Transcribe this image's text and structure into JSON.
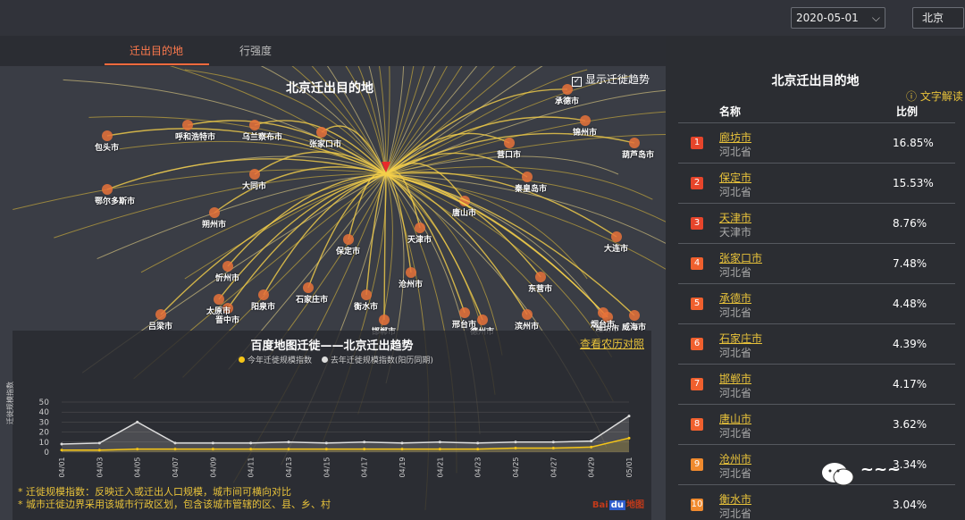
{
  "topbar": {
    "date": "2020-05-01",
    "city": "北京"
  },
  "tabs": {
    "destination": "迁出目的地",
    "intensity": "行强度"
  },
  "map": {
    "title": "北京迁出目的地",
    "trend_toggle": "显示迁徙趋势",
    "origin": "北京",
    "cities": [
      "包头市",
      "呼和浩特市",
      "乌兰察布市",
      "张家口市",
      "秦皇岛市",
      "鄂尔多斯市",
      "大同市",
      "唐山市",
      "朔州市",
      "保定市",
      "天津市",
      "沧州市",
      "忻州市",
      "石家庄市",
      "太原市",
      "晋中市",
      "阳泉市",
      "邯郸市",
      "吕梁市",
      "衡水市",
      "邢台市",
      "德州市",
      "滨州市",
      "东营市",
      "潍坊市",
      "烟台市",
      "威海市",
      "大连市",
      "营口市",
      "锦州市",
      "葫芦岛市",
      "承德市"
    ]
  },
  "trend": {
    "title": "百度地图迁徙——北京迁出趋势",
    "lunar_link": "查看农历对照",
    "legend_this_year": "今年迁徙规模指数",
    "legend_last_year": "去年迁徙规模指数(阳历同期)",
    "y_axis_label": "迁徙规模指数",
    "notes": [
      "* 迁徙规模指数：反映迁入或迁出人口规模，城市间可横向对比",
      "* 城市迁徙边界采用该城市行政区划，包含该城市管辖的区、县、乡、村"
    ],
    "logo": "Bai du 地图"
  },
  "panel": {
    "title": "北京迁出目的地",
    "interpret": "文字解读",
    "col_name": "名称",
    "col_ratio": "比例",
    "rows": [
      {
        "rank": "1",
        "name": "廊坊市",
        "province": "河北省",
        "pct": "16.85%",
        "color": "#e7452b"
      },
      {
        "rank": "2",
        "name": "保定市",
        "province": "河北省",
        "pct": "15.53%",
        "color": "#e7452b"
      },
      {
        "rank": "3",
        "name": "天津市",
        "province": "天津市",
        "pct": "8.76%",
        "color": "#e7452b"
      },
      {
        "rank": "4",
        "name": "张家口市",
        "province": "河北省",
        "pct": "7.48%",
        "color": "#f0602e"
      },
      {
        "rank": "5",
        "name": "承德市",
        "province": "河北省",
        "pct": "4.48%",
        "color": "#f0602e"
      },
      {
        "rank": "6",
        "name": "石家庄市",
        "province": "河北省",
        "pct": "4.39%",
        "color": "#f0602e"
      },
      {
        "rank": "7",
        "name": "邯郸市",
        "province": "河北省",
        "pct": "4.17%",
        "color": "#f0602e"
      },
      {
        "rank": "8",
        "name": "唐山市",
        "province": "河北省",
        "pct": "3.62%",
        "color": "#f0602e"
      },
      {
        "rank": "9",
        "name": "沧州市",
        "province": "河北省",
        "pct": "3.34%",
        "color": "#f08a2e"
      },
      {
        "rank": "10",
        "name": "衡水市",
        "province": "河北省",
        "pct": "3.04%",
        "color": "#f08a2e"
      }
    ]
  },
  "chart_data": {
    "type": "line",
    "title": "百度地图迁徙——北京迁出趋势",
    "ylabel": "迁徙规模指数",
    "ylim": [
      0,
      50
    ],
    "yticks": [
      0,
      10,
      20,
      30,
      40,
      50
    ],
    "x": [
      "04/01",
      "04/03",
      "04/05",
      "04/07",
      "04/09",
      "04/11",
      "04/13",
      "04/15",
      "04/17",
      "04/19",
      "04/21",
      "04/23",
      "04/25",
      "04/27",
      "04/29",
      "05/01"
    ],
    "series": [
      {
        "name": "今年迁徙规模指数",
        "color": "#f5c518",
        "values": [
          2,
          2,
          3,
          3,
          3,
          3,
          3,
          3,
          3,
          3,
          3,
          3,
          4,
          4,
          5,
          14
        ]
      },
      {
        "name": "去年迁徙规模指数(阳历同期)",
        "color": "#dddddd",
        "values": [
          8,
          9,
          30,
          9,
          9,
          9,
          10,
          9,
          10,
          9,
          10,
          9,
          10,
          10,
          11,
          36
        ]
      }
    ]
  },
  "watermark": "~~~"
}
